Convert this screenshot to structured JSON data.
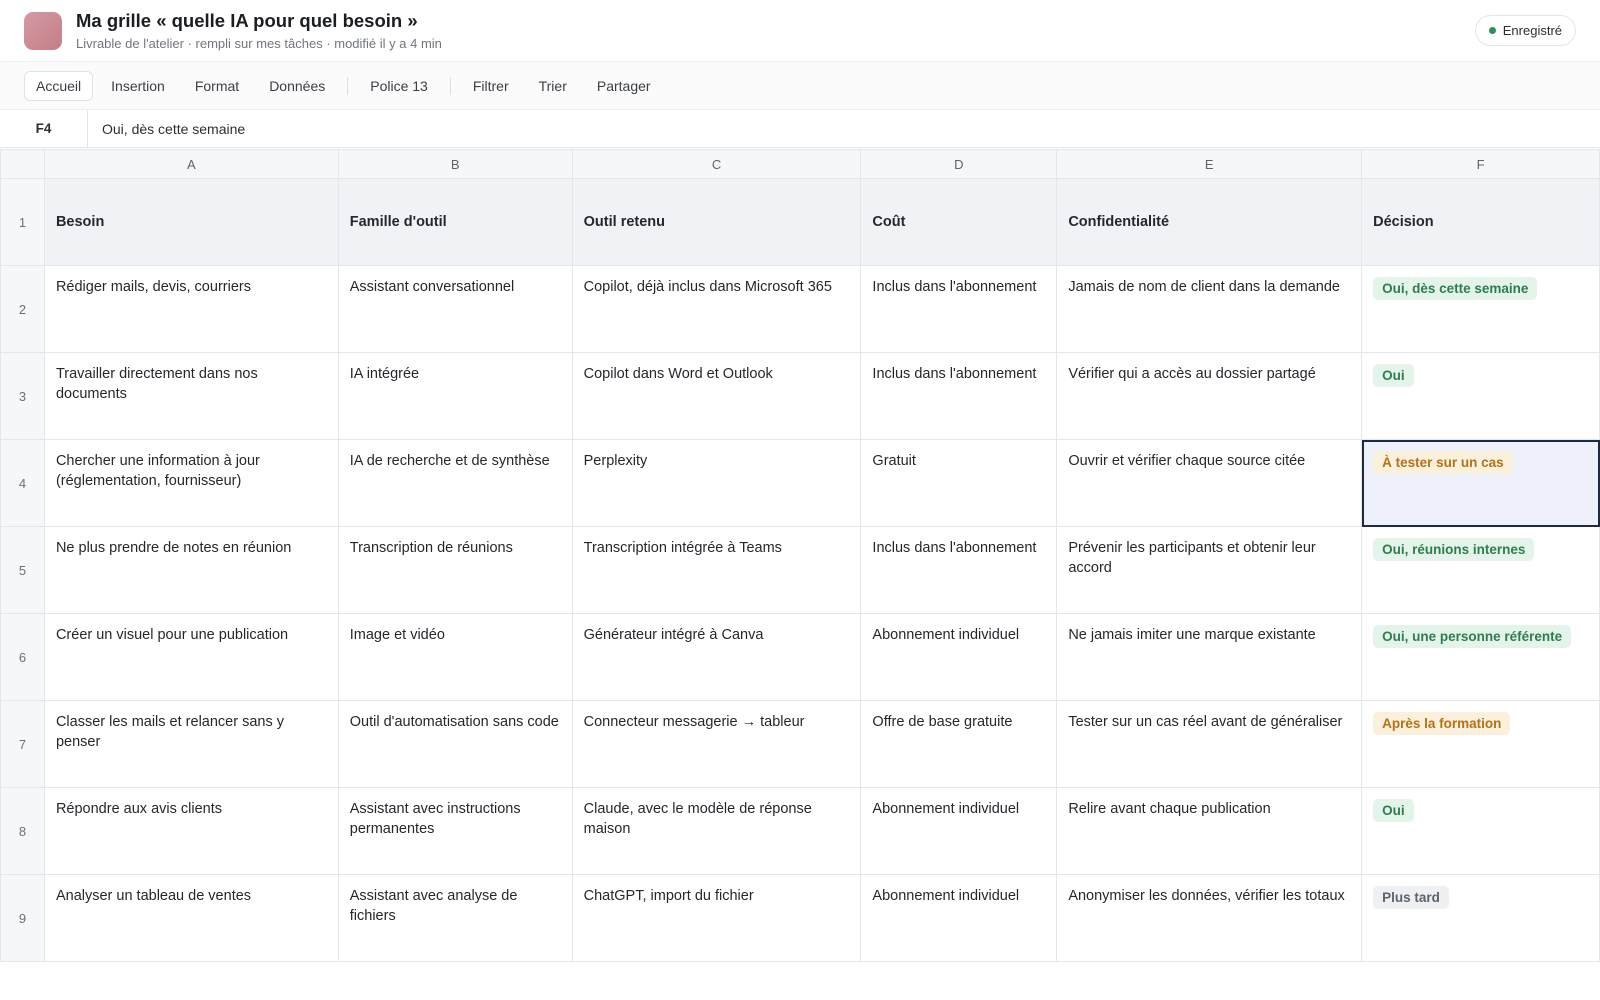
{
  "app": {
    "title": "Ma grille « quelle IA pour quel besoin »",
    "subtitle": "Livrable de l'atelier · rempli sur mes tâches · modifié il y a 4 min",
    "save_status": "Enregistré"
  },
  "toolbar": {
    "items": [
      "Accueil",
      "Insertion",
      "Format",
      "Données",
      "Police 13",
      "Filtrer",
      "Trier",
      "Partager"
    ]
  },
  "formula_bar": {
    "cell_ref": "F4",
    "value": "Oui, dès cette semaine"
  },
  "columns": [
    "A",
    "B",
    "C",
    "D",
    "E",
    "F"
  ],
  "header_row": {
    "number": "1",
    "cells": [
      "Besoin",
      "Famille d'outil",
      "Outil retenu",
      "Coût",
      "Confidentialité",
      "Décision"
    ]
  },
  "rows": [
    {
      "number": "2",
      "cells": [
        "Rédiger mails, devis, courriers",
        "Assistant conversationnel",
        "Copilot, déjà inclus dans Microsoft 365",
        "Inclus dans l'abonnement",
        "Jamais de nom de client dans la demande"
      ],
      "decision": "Oui, dès cette semaine",
      "decision_status": "green"
    },
    {
      "number": "3",
      "cells": [
        "Travailler directement dans nos documents",
        "IA intégrée",
        "Copilot dans Word et Outlook",
        "Inclus dans l'abonnement",
        "Vérifier qui a accès au dossier partagé"
      ],
      "decision": "Oui",
      "decision_status": "green"
    },
    {
      "number": "4",
      "cells": [
        "Chercher une information à jour (réglementation, fournisseur)",
        "IA de recherche et de synthèse",
        "Perplexity",
        "Gratuit",
        "Ouvrir et vérifier chaque source citée"
      ],
      "decision": "À tester sur un cas",
      "decision_status": "orange"
    },
    {
      "number": "5",
      "cells": [
        "Ne plus prendre de notes en réunion",
        "Transcription de réunions",
        "Transcription intégrée à Teams",
        "Inclus dans l'abonnement",
        "Prévenir les participants et obtenir leur accord"
      ],
      "decision": "Oui, réunions internes",
      "decision_status": "green"
    },
    {
      "number": "6",
      "cells": [
        "Créer un visuel pour une publication",
        "Image et vidéo",
        "Générateur intégré à Canva",
        "Abonnement individuel",
        "Ne jamais imiter une marque existante"
      ],
      "decision": "Oui, une personne référente",
      "decision_status": "green"
    },
    {
      "number": "7",
      "cells": [
        "Classer les mails et relancer sans y penser",
        "Outil d'automatisation sans code",
        "Connecteur messagerie → tableur",
        "Offre de base gratuite",
        "Tester sur un cas réel avant de généraliser"
      ],
      "decision": "Après la formation",
      "decision_status": "orange"
    },
    {
      "number": "8",
      "cells": [
        "Répondre aux avis clients",
        "Assistant avec instructions permanentes",
        "Claude, avec le modèle de réponse maison",
        "Abonnement individuel",
        "Relire avant chaque publication"
      ],
      "decision": "Oui",
      "decision_status": "green"
    },
    {
      "number": "9",
      "cells": [
        "Analyser un tableau de ventes",
        "Assistant avec analyse de fichiers",
        "ChatGPT, import du fichier",
        "Abonnement individuel",
        "Anonymiser les données, vérifier les totaux"
      ],
      "decision": "Plus tard",
      "decision_status": "gray"
    }
  ],
  "selected_cell": "F4",
  "colors": {
    "status_green": "#2f7d4f",
    "status_orange": "#b3711a",
    "status_gray": "#5d636b",
    "selection_border": "#1e2a3d"
  }
}
